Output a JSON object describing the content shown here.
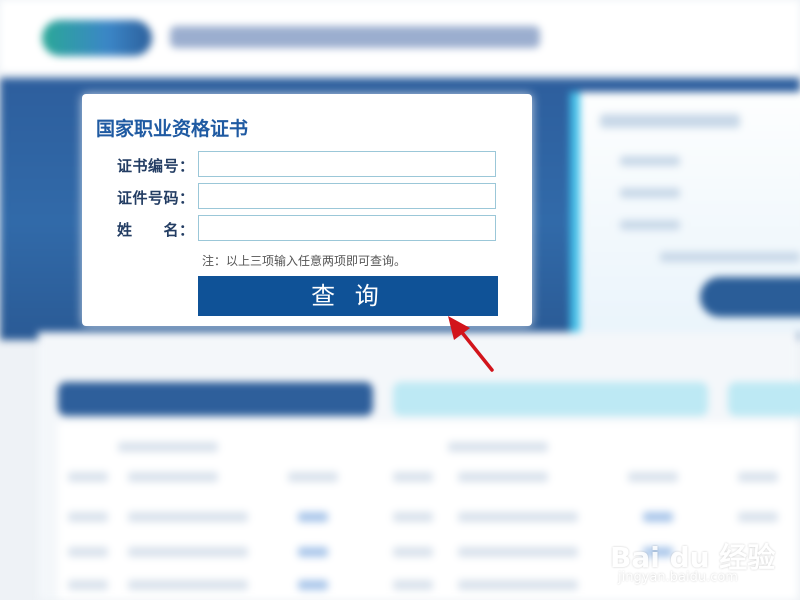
{
  "query_panel": {
    "title": "国家职业资格证书",
    "fields": [
      {
        "label": "证书编号：",
        "value": "",
        "placeholder": ""
      },
      {
        "label": "证件号码：",
        "value": "",
        "placeholder": ""
      },
      {
        "label": "姓　　名：",
        "value": "",
        "placeholder": ""
      }
    ],
    "note": "注：以上三项输入任意两项即可查询。",
    "submit_label": "查 询"
  },
  "watermark": {
    "brand": "Bai du 经验",
    "url": "jingyan.baidu.com"
  },
  "colors": {
    "title": "#1f5aa2",
    "button_bg": "#0f5297",
    "input_border": "#9bc7d8",
    "annotation_arrow": "#d2141b",
    "background_band": "#2d5e9d"
  }
}
